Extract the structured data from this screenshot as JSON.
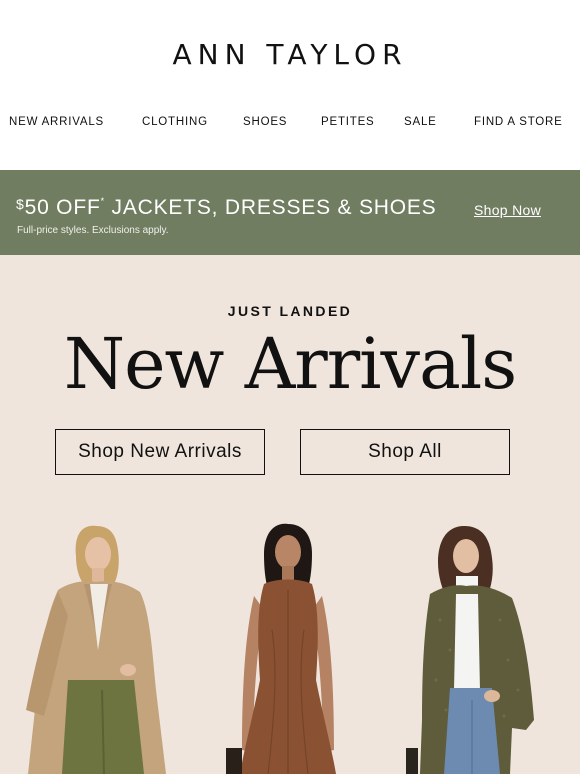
{
  "brand": {
    "logo_text": "ANN TAYLOR"
  },
  "nav": {
    "items": [
      "NEW ARRIVALS",
      "CLOTHING",
      "SHOES",
      "PETITES",
      "SALE",
      "FIND A STORE"
    ]
  },
  "promo": {
    "dollar": "$",
    "amount": "50 OFF",
    "asterisk": "*",
    "headline_rest": " JACKETS, DRESSES & SHOES",
    "subtext": "Full-price styles. Exclusions apply.",
    "link_label": "Shop Now",
    "bg_color": "#717d61"
  },
  "hero": {
    "eyebrow": "JUST LANDED",
    "title": "New Arrivals",
    "buttons": [
      "Shop New Arrivals",
      "Shop All"
    ],
    "bg_color": "#efe5dd"
  },
  "models": [
    {
      "name": "model-trench-coat",
      "outfit": "camel trench coat, cream blouse, olive corduroy trousers"
    },
    {
      "name": "model-leather-dress",
      "outfit": "brown faux-leather sleeveless dress"
    },
    {
      "name": "model-tweed-blazer",
      "outfit": "olive tweed blazer, white turtleneck, blue jeans"
    }
  ]
}
